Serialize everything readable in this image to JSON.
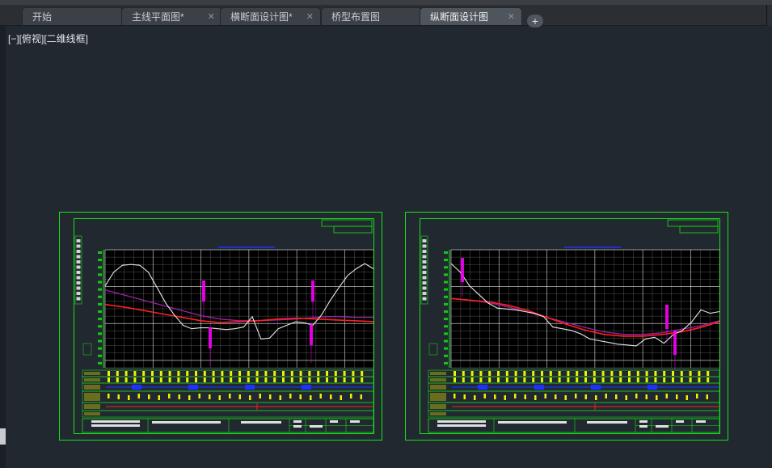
{
  "tabs": [
    {
      "label": "开始",
      "closable": false,
      "active": false
    },
    {
      "label": "主线平面图*",
      "closable": true,
      "active": false
    },
    {
      "label": "横断面设计图*",
      "closable": true,
      "active": false
    },
    {
      "label": "桥型布置图",
      "closable": false,
      "active": false
    },
    {
      "label": "纵断面设计图",
      "closable": true,
      "active": true
    }
  ],
  "add_tab_glyph": "+",
  "close_glyph": "✕",
  "viewport": {
    "label": "[−][俯视][二维线框]"
  },
  "colors": {
    "background": "#212830",
    "frame": "#18e018",
    "grid": "#ffffff",
    "ground_line": "#e6e6e6",
    "design_line": "#ff2020",
    "design_line_2": "#a020a0",
    "annotation": "#ff00ff",
    "data_row": "#f0f000",
    "blue_marks": "#2030ff"
  },
  "icons": {
    "close": "close-icon",
    "add": "plus-icon"
  },
  "sheets": [
    {
      "id": "sheet-1",
      "ground_profile": [
        0.72,
        0.88,
        0.96,
        0.97,
        0.96,
        0.88,
        0.7,
        0.52,
        0.38,
        0.26,
        0.22,
        0.23,
        0.23,
        0.22,
        0.21,
        0.22,
        0.24,
        0.36,
        0.1,
        0.11,
        0.22,
        0.26,
        0.3,
        0.29,
        0.26,
        0.38,
        0.55,
        0.7,
        0.84,
        0.92,
        0.98,
        0.92
      ],
      "design_red": [
        0.55,
        0.52,
        0.48,
        0.44,
        0.4,
        0.36,
        0.34,
        0.35,
        0.36,
        0.38,
        0.39,
        0.38,
        0.37,
        0.36,
        0.35
      ],
      "design_purple": [
        0.72,
        0.66,
        0.6,
        0.54,
        0.48,
        0.42,
        0.38,
        0.36,
        0.36,
        0.37,
        0.38,
        0.4,
        0.41,
        0.4,
        0.4
      ]
    },
    {
      "id": "sheet-2",
      "ground_profile": [
        0.98,
        0.88,
        0.72,
        0.62,
        0.52,
        0.46,
        0.45,
        0.44,
        0.42,
        0.4,
        0.36,
        0.24,
        0.22,
        0.2,
        0.16,
        0.1,
        0.08,
        0.06,
        0.04,
        0.03,
        0.02,
        0.1,
        0.12,
        0.05,
        0.15,
        0.2,
        0.3,
        0.44,
        0.4,
        0.42
      ],
      "design_red": [
        0.62,
        0.6,
        0.58,
        0.54,
        0.48,
        0.4,
        0.32,
        0.25,
        0.2,
        0.18,
        0.18,
        0.2,
        0.23,
        0.28,
        0.35
      ],
      "design_purple": [
        0.62,
        0.6,
        0.57,
        0.52,
        0.46,
        0.4,
        0.34,
        0.28,
        0.23,
        0.2,
        0.2,
        0.22,
        0.26,
        0.3,
        0.36
      ]
    }
  ]
}
